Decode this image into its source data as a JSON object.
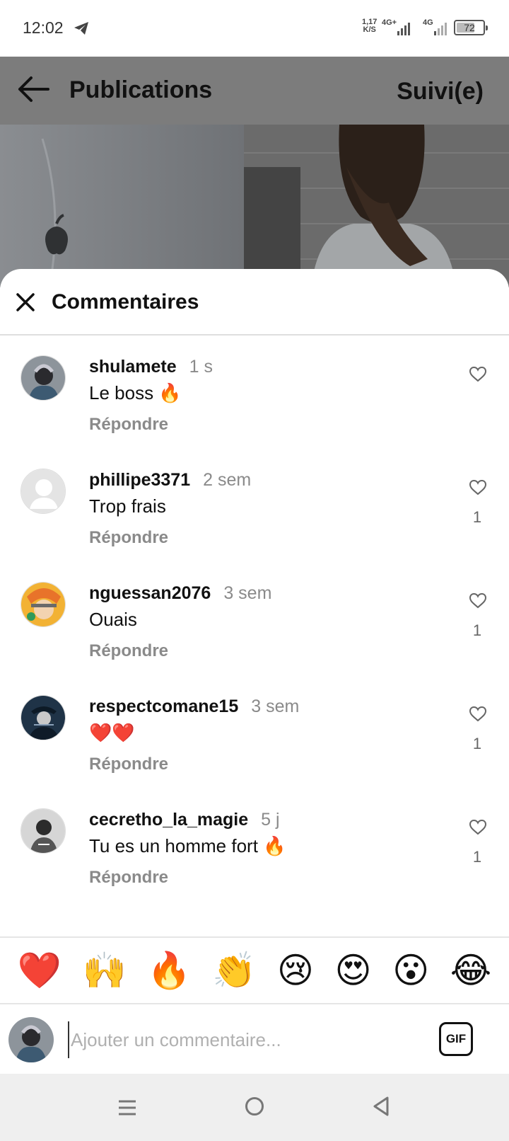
{
  "status_bar": {
    "time": "12:02",
    "net_speed_value": "1,17",
    "net_speed_unit": "K/S",
    "signal1_label": "4G+",
    "signal2_label": "4G",
    "battery": "72",
    "battery_level": 0.72
  },
  "header": {
    "title": "Publications",
    "follow_label": "Suivi(e)"
  },
  "sheet": {
    "title": "Commentaires"
  },
  "comments": [
    {
      "username": "shulamete",
      "time": "1 s",
      "text": "Le boss 🔥",
      "reply": "Répondre",
      "likes": ""
    },
    {
      "username": "phillipe3371",
      "time": "2 sem",
      "text": "Trop frais",
      "reply": "Répondre",
      "likes": "1"
    },
    {
      "username": "nguessan2076",
      "time": "3 sem",
      "text": "Ouais",
      "reply": "Répondre",
      "likes": "1"
    },
    {
      "username": "respectcomane15",
      "time": "3 sem",
      "text": "❤️❤️",
      "reply": "Répondre",
      "likes": "1"
    },
    {
      "username": "cecretho_la_magie",
      "time": "5 j",
      "text": "Tu es un homme fort 🔥",
      "reply": "Répondre",
      "likes": "1"
    }
  ],
  "emoji_bar": [
    "❤️",
    "🙌",
    "🔥",
    "👏",
    "😢",
    "😍",
    "😮",
    "😂"
  ],
  "input": {
    "placeholder": "Ajouter un commentaire...",
    "value": "",
    "gif_label": "GIF"
  },
  "colors": {
    "overlay": "#7c7c7c",
    "muted_text": "#8a8a8a",
    "divider": "#dedede"
  },
  "icons": [
    "telegram-icon",
    "back-arrow-icon",
    "close-icon",
    "heart-icon",
    "menu-icon",
    "home-icon",
    "back-icon"
  ]
}
